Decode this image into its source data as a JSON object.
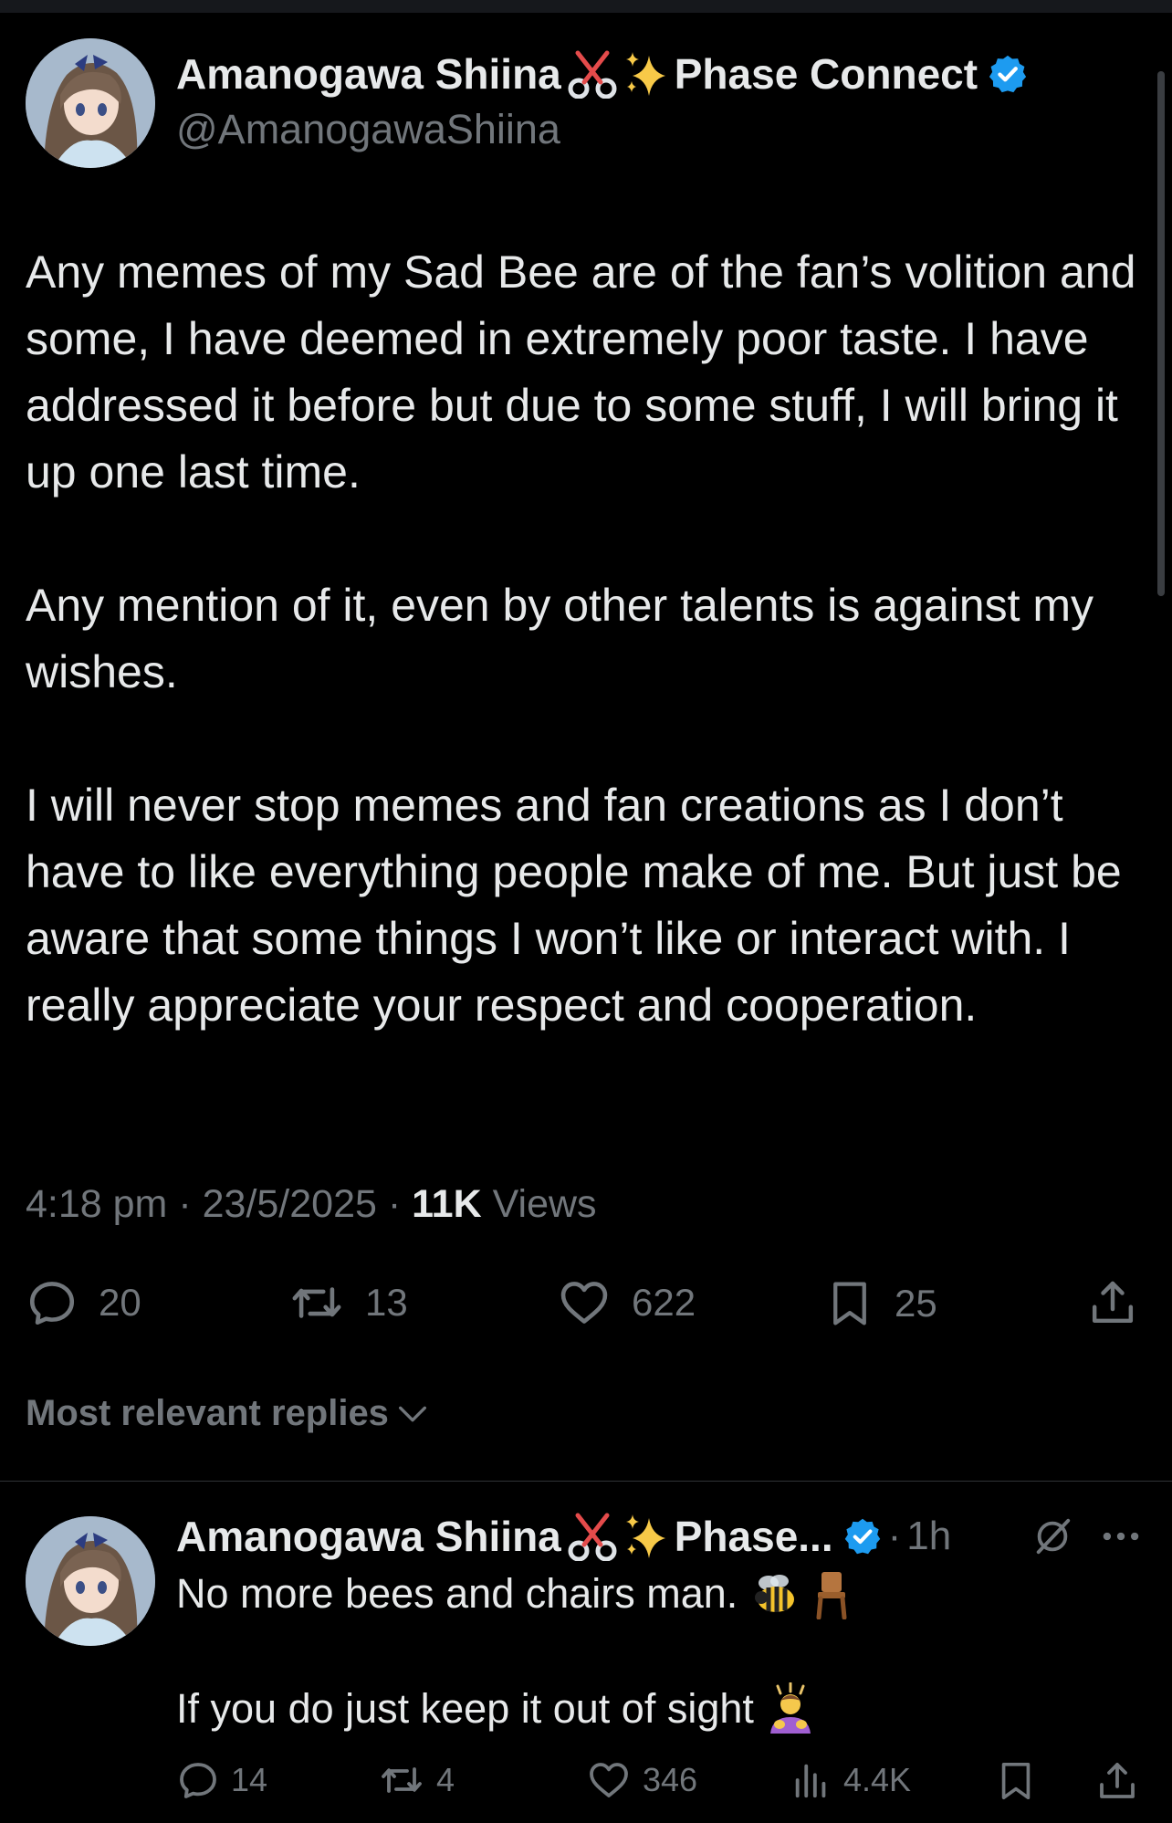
{
  "main_tweet": {
    "author_name": "Amanogawa Shiina",
    "author_suffix": "Phase Connect",
    "handle": "@AmanogawaShiina",
    "paragraphs": [
      "Any memes of my Sad Bee are of the fan’s volition and some, I have deemed in extremely poor taste. I have addressed it before but due to some stuff, I will bring it up one last time.",
      "Any mention of it, even by other talents is against my wishes.",
      "I will never stop memes and fan creations as I don’t have to like everything people make of me. But just be aware that some things I won’t like or interact with. I really appreciate your respect and cooperation."
    ],
    "time": "4:18 pm",
    "date": "23/5/2025",
    "views_count": "11K",
    "views_label": "Views",
    "replies": "20",
    "reposts": "13",
    "likes": "622",
    "bookmarks": "25"
  },
  "replies_filter": {
    "label": "Most relevant replies"
  },
  "reply": {
    "author_name": "Amanogawa Shiina",
    "author_suffix": "Phase...",
    "time_ago": "1h",
    "line1": "No more bees and chairs man.",
    "line2": "If you do just keep it out of sight",
    "replies": "14",
    "reposts": "4",
    "likes": "346",
    "views": "4.4K"
  },
  "icons": {
    "scissors": "scissors-icon",
    "sparkles": "sparkles-icon",
    "verified": "verified-badge-icon",
    "reply": "reply-icon",
    "repost": "repost-icon",
    "like": "heart-icon",
    "bookmark": "bookmark-icon",
    "share": "share-icon",
    "views": "views-icon",
    "chevron": "chevron-down-icon",
    "grok": "grok-icon",
    "more": "more-icon",
    "bee": "bee-icon",
    "chair": "chair-icon",
    "person": "person-bowing-icon"
  },
  "colors": {
    "background": "#000000",
    "text": "#e7e9ea",
    "secondary": "#71767b",
    "verified": "#1d9bf0",
    "divider": "#2f3336"
  }
}
